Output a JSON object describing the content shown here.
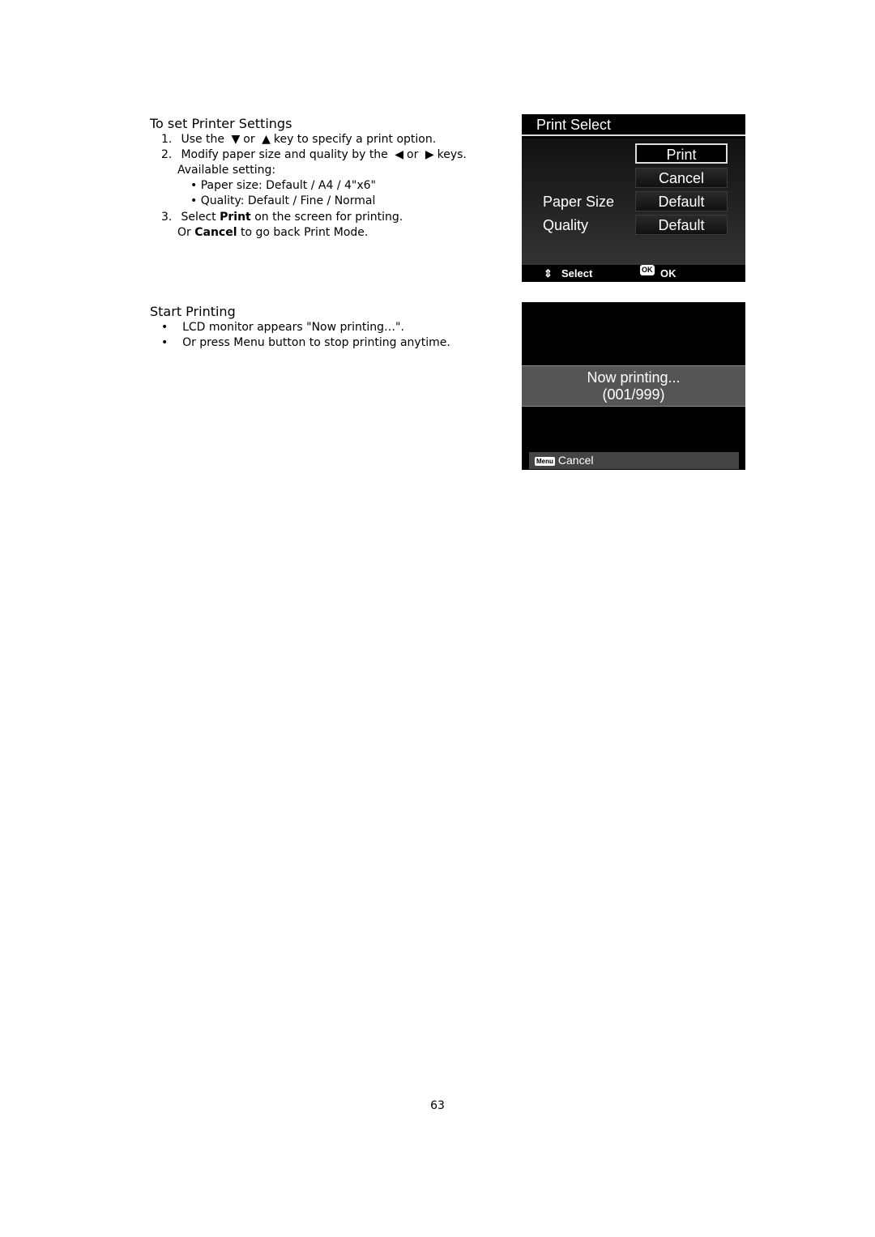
{
  "section1": {
    "title": "To set Printer Settings",
    "step1": {
      "num": "1.",
      "pre": "Use the",
      "down_icon": "▼",
      "or": "or",
      "up_icon": "▲",
      "post": "key to specify a print option."
    },
    "step2": {
      "num": "2.",
      "pre": "Modify paper size and quality by the",
      "left_icon": "◀",
      "or": "or",
      "right_icon": "▶",
      "post": "keys."
    },
    "available": "Available setting:",
    "bullets": [
      "Paper size: Default / A4 / 4\"x6\"",
      "Quality: Default / Fine / Normal"
    ],
    "step3": {
      "num": "3.",
      "pre": "Select",
      "bold": "Print",
      "post": "on the screen for printing."
    },
    "step3b": {
      "pre": "Or",
      "bold": "Cancel",
      "post": "to go back Print Mode."
    }
  },
  "screen1": {
    "title": "Print Select",
    "options": [
      "Print",
      "Cancel",
      "Default",
      "Default"
    ],
    "labels": {
      "paper_size": "Paper Size",
      "quality": "Quality"
    },
    "footer": {
      "select_icon": "⇕",
      "select": "Select",
      "ok_badge": "OK",
      "ok": "OK"
    }
  },
  "section2": {
    "title": "Start Printing",
    "bullets": [
      "LCD monitor appears \"Now printing…\".",
      "Or press Menu button to stop printing anytime."
    ]
  },
  "screen2": {
    "line1": "Now printing...",
    "line2": "(001/999)",
    "menu_badge": "Menu",
    "cancel": "Cancel"
  },
  "page_number": "63"
}
